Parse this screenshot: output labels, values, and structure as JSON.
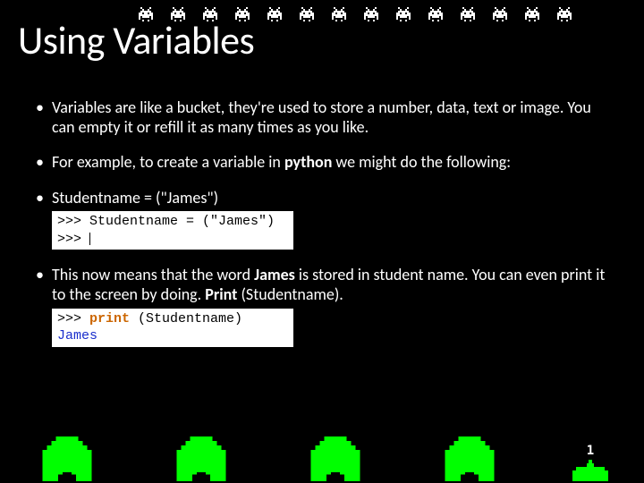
{
  "title": "Using Variables",
  "bullets": {
    "b1": "Variables are like a bucket, they're used to store a number, data, text or image. You can empty it or refill it as many times as you like.",
    "b2_pre": "For example, to create a variable in ",
    "b2_bold": "python",
    "b2_post": " we might do the following:",
    "b3": "Studentname = (\"James\")",
    "b4_pre": "This now means that the word ",
    "b4_bold1": "James",
    "b4_mid": " is stored in student name. You can even print it to the screen by doing. ",
    "b4_bold2": "Print",
    "b4_post": " (Studentname)."
  },
  "code1": {
    "line1": ">>> Studentname = (\"James\")",
    "line2": ">>> "
  },
  "code2": {
    "line1_prompt": ">>> ",
    "line1_fn": "print",
    "line1_rest": " (Studentname)",
    "line2": "James"
  },
  "ship": {
    "lives": "1"
  },
  "decor": {
    "invaders_count": 14,
    "bunkers_count": 4
  }
}
